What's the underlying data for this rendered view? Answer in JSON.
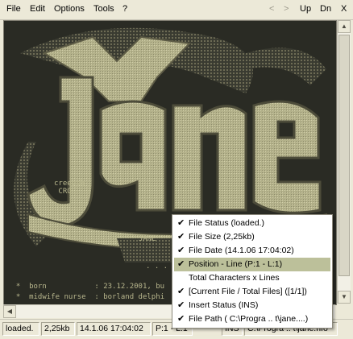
{
  "menubar": {
    "file": "File",
    "edit": "Edit",
    "options": "Options",
    "tools": "Tools",
    "help": "?",
    "prev": "<",
    "next": ">",
    "up": "Up",
    "down": "Dn",
    "close": "X"
  },
  "art": {
    "tag": "creepah\n CRO",
    "sig": "JANE",
    "line1": "  *  born           : 23.12.2001, bu",
    "line2": "  *  midwife nurse  : borland delphi",
    "dots": ". . . m"
  },
  "context_menu": [
    {
      "label": "File Status (loaded.)",
      "checked": true
    },
    {
      "label": "File Size (2,25kb)",
      "checked": true
    },
    {
      "label": "File Date (14.1.06 17:04:02)",
      "checked": true
    },
    {
      "label": "Position - Line (P:1 - L:1)",
      "checked": true
    },
    {
      "label": "Total Characters x Lines",
      "checked": false
    },
    {
      "label": "[Current File / Total Files] ([1/1])",
      "checked": true
    },
    {
      "label": "Insert Status (INS)",
      "checked": true
    },
    {
      "label": "File Path ( C:\\Progra .. t\\jane....)",
      "checked": true
    }
  ],
  "status": {
    "loaded": "loaded.",
    "size": "2,25kb",
    "date": "14.1.06 17:04:02",
    "pos": "P:1 - L:1",
    "ins": "INS",
    "path": "C:\\Progra .. t\\jane.nfo"
  },
  "colors": {
    "art_fg": "#b8b68d",
    "art_bg": "#2a2b24",
    "menu_highlight": "#bcc09a"
  }
}
